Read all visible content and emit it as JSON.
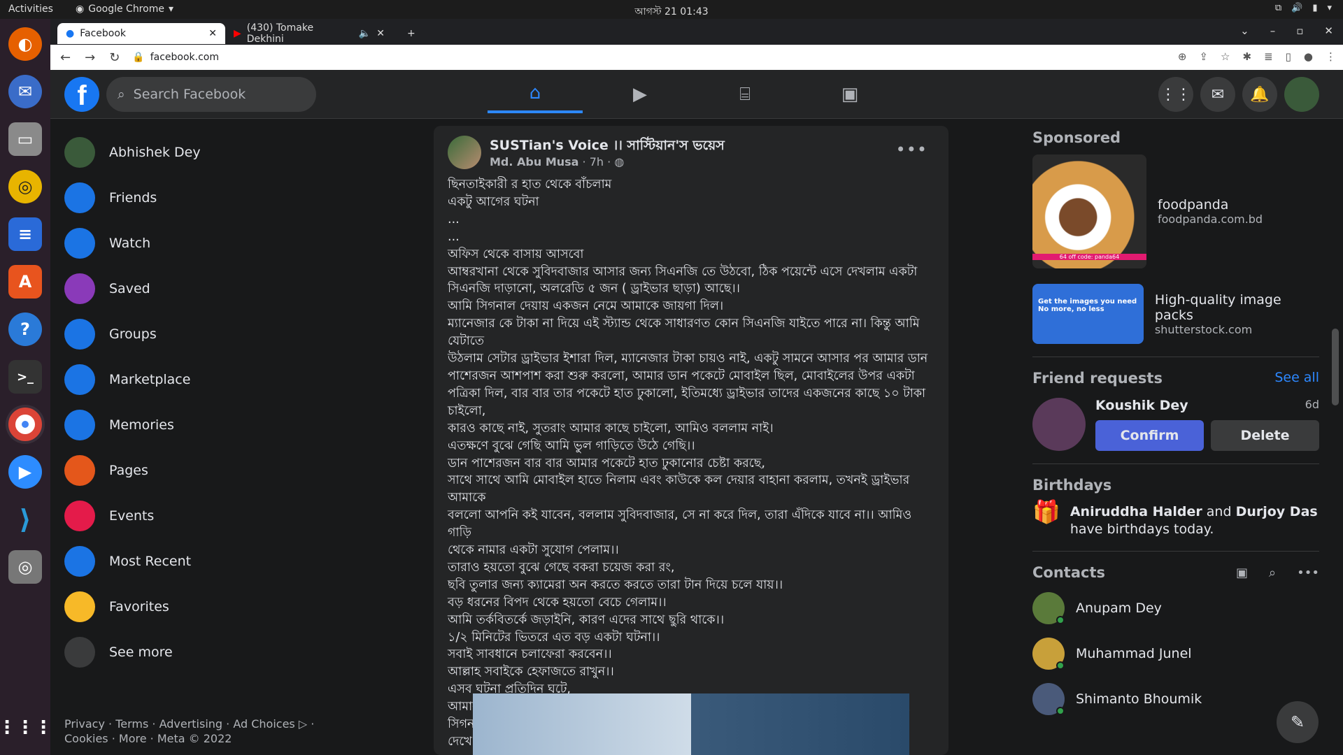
{
  "system": {
    "activities": "Activities",
    "app": "Google Chrome",
    "clock": "আগস্ট 21  01:43"
  },
  "browser": {
    "tabs": [
      {
        "label": "Facebook"
      },
      {
        "label": "(430) Tomake Dekhini"
      }
    ],
    "url": "facebook.com"
  },
  "fb": {
    "search_placeholder": "Search Facebook"
  },
  "left_nav": [
    {
      "label": "Abhishek Dey",
      "icon": "profile-avatar",
      "color": "#3a5a3a"
    },
    {
      "label": "Friends",
      "icon": "friends-icon",
      "color": "#1b74e4"
    },
    {
      "label": "Watch",
      "icon": "watch-icon",
      "color": "#1b74e4"
    },
    {
      "label": "Saved",
      "icon": "saved-icon",
      "color": "#8a3ab9"
    },
    {
      "label": "Groups",
      "icon": "groups-icon",
      "color": "#1b74e4"
    },
    {
      "label": "Marketplace",
      "icon": "marketplace-icon",
      "color": "#1b74e4"
    },
    {
      "label": "Memories",
      "icon": "memories-icon",
      "color": "#1b74e4"
    },
    {
      "label": "Pages",
      "icon": "pages-icon",
      "color": "#e4571b"
    },
    {
      "label": "Events",
      "icon": "events-icon",
      "color": "#e41b4a"
    },
    {
      "label": "Most Recent",
      "icon": "most-recent-icon",
      "color": "#1b74e4"
    },
    {
      "label": "Favorites",
      "icon": "favorites-icon",
      "color": "#f7b928"
    },
    {
      "label": "See more",
      "icon": "chevron-down-icon",
      "color": "#3a3b3c"
    }
  ],
  "footer": "Privacy · Terms · Advertising · Ad Choices ▷ · Cookies · More · Meta © 2022",
  "post": {
    "page_name": "SUSTian's Voice ।। সাস্টিয়ান'স ভয়েস",
    "author": "Md. Abu Musa",
    "time": "7h",
    "lines": [
      "ছিনতাইকারী র হাত থেকে বাঁচলাম",
      "একটু আগের ঘটনা",
      "...",
      "...",
      "অফিস থেকে বাসায় আসবো",
      "আম্বরখানা থেকে সুবিদবাজার আসার জন্য সিএনজি তে উঠবো, ঠিক পয়েন্টে এসে দেখলাম একটা",
      "সিএনজি দাড়ানো, অলরেডি ৫ জন ( ড্রাইভার ছাড়া)  আছে।।",
      "আমি সিগনাল দেয়ায় একজন নেমে আমাকে জায়গা দিল।",
      "ম্যানেজার কে টাকা না দিয়ে এই স্ট্যান্ড থেকে সাধারণত কোন সিএনজি যাইতে পারে না। কিন্তু আমি যেটাতে",
      "উঠলাম সেটার ড্রাইভার ইশারা দিল, ম্যানেজার টাকা চায়ও নাই, একটু সামনে আসার পর আমার ডান",
      "পাশেরজন আশপাশ করা শুরু করলো, আমার ডান পকেটে মোবাইল ছিল, মোবাইলের উপর একটা",
      "পত্রিকা দিল, বার বার তার পকেটে হাত ঢুকালো, ইতিমধ্যে ড্রাইভার তাদের একজনের কাছে ১০ টাকা",
      "চাইলো,",
      "কারও কাছে নাই, সুতরাং আমার কাছে চাইলো, আমিও বললাম নাই।",
      "এতক্ষণে বুঝে গেছি আমি ভুল গাড়িতে উঠে গেছি।।",
      "ডান পাশেরজন বার বার আমার পকেটে হাত ঢুকানোর চেষ্টা করছে,",
      "সাথে সাথে আমি মোবাইল হাতে নিলাম এবং কাউকে কল দেয়ার বাহানা করলাম, তখনই ড্রাইভার আমাকে",
      "বললো আপনি কই যাবেন, বললাম সুবিদবাজার, সে না করে দিল, তারা এঁদিকে যাবে না।। আমিও গাড়ি",
      "থেকে নামার একটা সুযোগ পেলাম।।",
      "তারাও হয়তো বুঝে গেছে বকরা চয়েজ করা রং,",
      "ছবি তুলার জন্য ক্যামেরা অন করতে করতে তারা টান দিয়ে চলে যায়।।",
      "বড় ধরনের বিপদ থেকে হয়তো বেচে গেলাম।।",
      "আমি তর্কবিতর্কে জড়াইনি, কারণ এদের সাথে ছুরি থাকে।।",
      "১/২ মিনিটের ভিতরে এত বড় একটা ঘটনা।।",
      "সবাই সাবধানে চলাফেরা করবেন।।",
      "আল্লাহ সবাইকে হেফাজতে রাখুন।।",
      "এসব ঘটনা প্রতিদিন ঘটে,",
      "আমার কেন জানি বার বার মনে  হচ্ছে ম্যানেজার এই ঘটনার সাথে জড়িত, কারণ তার ইশারা এবং সিগনাল",
      "দেখে সন্দেহজনক লাগছে।।"
    ]
  },
  "sponsored": {
    "title": "Sponsored",
    "ads": [
      {
        "name": "foodpanda",
        "domain": "foodpanda.com.bd",
        "img_text": "64 off   code: panda64"
      },
      {
        "name": "High-quality image packs",
        "domain": "shutterstock.com",
        "img_text": "Get the images you need No more, no less"
      }
    ]
  },
  "friend_requests": {
    "title": "Friend requests",
    "see_all": "See all",
    "name": "Koushik Dey",
    "age": "6d",
    "confirm": "Confirm",
    "delete": "Delete"
  },
  "birthdays": {
    "title": "Birthdays",
    "name1": "Aniruddha Halder",
    "and": " and ",
    "name2": "Durjoy Das",
    "rest": " have birthdays today."
  },
  "contacts": {
    "title": "Contacts",
    "list": [
      {
        "name": "Anupam Dey",
        "color": "#5a7a3a"
      },
      {
        "name": "Muhammad Junel",
        "color": "#c8a03a"
      },
      {
        "name": "Shimanto Bhoumik",
        "color": "#4a5a7a"
      }
    ]
  }
}
